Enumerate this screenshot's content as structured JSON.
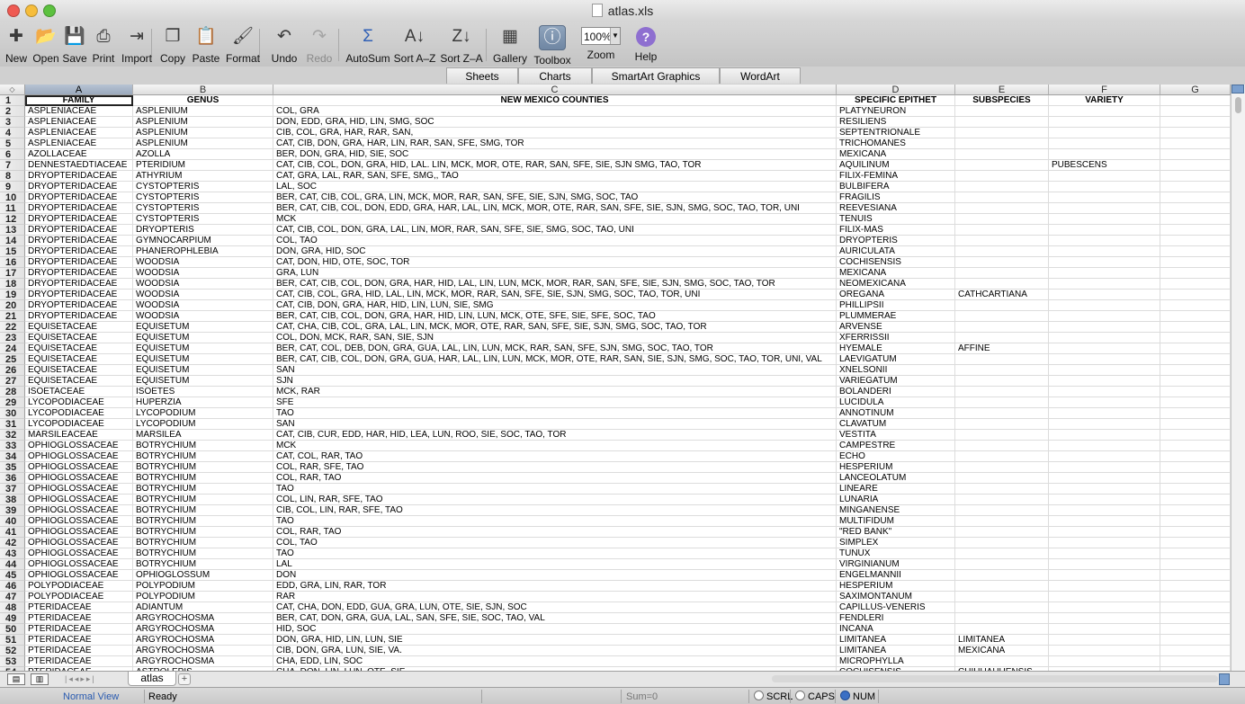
{
  "window": {
    "title": "atlas.xls"
  },
  "toolbar": {
    "items": [
      {
        "label": "New",
        "icon": "new-file-icon",
        "glyph": "✚"
      },
      {
        "label": "Open",
        "icon": "open-icon",
        "glyph": "📂"
      },
      {
        "label": "Save",
        "icon": "save-icon",
        "glyph": "💾"
      },
      {
        "label": "Print",
        "icon": "print-icon",
        "glyph": "⎙"
      },
      {
        "label": "Import",
        "icon": "import-icon",
        "glyph": "⇥"
      },
      {
        "label": "Copy",
        "icon": "copy-icon",
        "glyph": "❐"
      },
      {
        "label": "Paste",
        "icon": "paste-icon",
        "glyph": "📋"
      },
      {
        "label": "Format",
        "icon": "format-brush-icon",
        "glyph": "🖌"
      },
      {
        "label": "Undo",
        "icon": "undo-icon",
        "glyph": "↶"
      },
      {
        "label": "Redo",
        "icon": "redo-icon",
        "glyph": "↷"
      },
      {
        "label": "AutoSum",
        "icon": "autosum-icon",
        "glyph": "Σ"
      },
      {
        "label": "Sort A–Z",
        "icon": "sort-ascending-icon",
        "glyph": "A↓"
      },
      {
        "label": "Sort Z–A",
        "icon": "sort-descending-icon",
        "glyph": "Z↓"
      },
      {
        "label": "Gallery",
        "icon": "gallery-icon",
        "glyph": "▦"
      },
      {
        "label": "Toolbox",
        "icon": "toolbox-icon",
        "glyph": "ⓘ"
      },
      {
        "label": "Zoom",
        "icon": "zoom-icon",
        "glyph": ""
      },
      {
        "label": "Help",
        "icon": "help-icon",
        "glyph": "?"
      }
    ],
    "zoom_value": "100%"
  },
  "ribbon": {
    "tabs": [
      "Sheets",
      "Charts",
      "SmartArt Graphics",
      "WordArt"
    ]
  },
  "sheet": {
    "columns": [
      "A",
      "B",
      "C",
      "D",
      "E",
      "F",
      "G"
    ],
    "header_row": [
      "FAMILY",
      "GENUS",
      "NEW MEXICO COUNTIES",
      "SPECIFIC EPITHET",
      "SUBSPECIES",
      "VARIETY",
      ""
    ],
    "rows": [
      [
        "ASPLENIACEAE",
        "ASPLENIUM",
        "COL, GRA",
        "PLATYNEURON",
        "",
        ""
      ],
      [
        "ASPLENIACEAE",
        "ASPLENIUM",
        "DON, EDD, GRA, HID, LIN, SMG, SOC",
        "RESILIENS",
        "",
        ""
      ],
      [
        "ASPLENIACEAE",
        "ASPLENIUM",
        "CIB, COL, GRA, HAR, RAR, SAN,",
        "SEPTENTRIONALE",
        "",
        ""
      ],
      [
        "ASPLENIACEAE",
        "ASPLENIUM",
        "CAT, CIB, DON, GRA, HAR, LIN, RAR, SAN, SFE, SMG, TOR",
        "TRICHOMANES",
        "",
        ""
      ],
      [
        "AZOLLACEAE",
        "AZOLLA",
        "BER, DON, GRA, HID, SIE, SOC",
        "MEXICANA",
        "",
        ""
      ],
      [
        "DENNESTAEDTIACEAE",
        "PTERIDIUM",
        "CAT, CIB, COL, DON, GRA, HID, LAL. LIN, MCK, MOR, OTE, RAR, SAN, SFE, SIE, SJN SMG, TAO, TOR",
        "AQUILINUM",
        "",
        "PUBESCENS"
      ],
      [
        "DRYOPTERIDACEAE",
        "ATHYRIUM",
        "CAT, GRA, LAL, RAR, SAN, SFE, SMG,, TAO",
        "FILIX-FEMINA",
        "",
        ""
      ],
      [
        "DRYOPTERIDACEAE",
        "CYSTOPTERIS",
        "LAL, SOC",
        "BULBIFERA",
        "",
        ""
      ],
      [
        "DRYOPTERIDACEAE",
        "CYSTOPTERIS",
        "BER, CAT, CIB, COL, GRA, LIN, MCK, MOR, RAR, SAN, SFE, SIE, SJN, SMG, SOC, TAO",
        "FRAGILIS",
        "",
        ""
      ],
      [
        "DRYOPTERIDACEAE",
        "CYSTOPTERIS",
        "BER, CAT, CIB, COL, DON, EDD, GRA, HAR, LAL, LIN, MCK, MOR, OTE, RAR, SAN, SFE, SIE, SJN, SMG, SOC, TAO, TOR, UNI",
        "REEVESIANA",
        "",
        ""
      ],
      [
        "DRYOPTERIDACEAE",
        "CYSTOPTERIS",
        "MCK",
        "TENUIS",
        "",
        ""
      ],
      [
        "DRYOPTERIDACEAE",
        "DRYOPTERIS",
        "CAT, CIB, COL, DON, GRA, LAL, LIN, MOR, RAR, SAN, SFE, SIE, SMG, SOC, TAO, UNI",
        "FILIX-MAS",
        "",
        ""
      ],
      [
        "DRYOPTERIDACEAE",
        "GYMNOCARPIUM",
        "COL, TAO",
        "DRYOPTERIS",
        "",
        ""
      ],
      [
        "DRYOPTERIDACEAE",
        "PHANEROPHLEBIA",
        "DON, GRA, HID, SOC",
        "AURICULATA",
        "",
        ""
      ],
      [
        "DRYOPTERIDACEAE",
        "WOODSIA",
        "CAT, DON, HID, OTE, SOC, TOR",
        "COCHISENSIS",
        "",
        ""
      ],
      [
        "DRYOPTERIDACEAE",
        "WOODSIA",
        "GRA, LUN",
        "MEXICANA",
        "",
        ""
      ],
      [
        "DRYOPTERIDACEAE",
        "WOODSIA",
        "BER, CAT, CIB, COL, DON, GRA, HAR, HID, LAL, LIN, LUN, MCK, MOR, RAR, SAN, SFE, SIE, SJN, SMG, SOC, TAO, TOR",
        "NEOMEXICANA",
        "",
        ""
      ],
      [
        "DRYOPTERIDACEAE",
        "WOODSIA",
        "CAT, CIB, COL, GRA, HID, LAL, LIN, MCK, MOR, RAR, SAN, SFE, SIE, SJN, SMG, SOC, TAO, TOR, UNI",
        "OREGANA",
        "CATHCARTIANA",
        ""
      ],
      [
        "DRYOPTERIDACEAE",
        "WOODSIA",
        "CAT, CIB, DON, GRA, HAR, HID, LIN, LUN, SIE, SMG",
        "PHILLIPSII",
        "",
        ""
      ],
      [
        "DRYOPTERIDACEAE",
        "WOODSIA",
        "BER, CAT, CIB, COL, DON, GRA, HAR, HID, LIN, LUN, MCK, OTE, SFE, SIE, SFE, SOC, TAO",
        "PLUMMERAE",
        "",
        ""
      ],
      [
        "EQUISETACEAE",
        "EQUISETUM",
        "CAT, CHA, CIB, COL, GRA, LAL, LIN, MCK, MOR, OTE, RAR, SAN, SFE, SIE, SJN, SMG, SOC, TAO, TOR",
        "ARVENSE",
        "",
        ""
      ],
      [
        "EQUISETACEAE",
        "EQUISETUM",
        "COL, DON, MCK, RAR, SAN, SIE, SJN",
        "XFERRISSII",
        "",
        ""
      ],
      [
        "EQUISETACEAE",
        "EQUISETUM",
        "BER, CAT, COL, DEB, DON, GRA, GUA, LAL, LIN, LUN, MCK, RAR, SAN, SFE, SJN, SMG, SOC, TAO, TOR",
        "HYEMALE",
        "AFFINE",
        ""
      ],
      [
        "EQUISETACEAE",
        "EQUISETUM",
        "BER, CAT, CIB, COL, DON, GRA, GUA, HAR, LAL, LIN, LUN, MCK, MOR, OTE, RAR, SAN, SIE, SJN, SMG, SOC, TAO, TOR, UNI, VAL",
        "LAEVIGATUM",
        "",
        ""
      ],
      [
        "EQUISETACEAE",
        "EQUISETUM",
        "SAN",
        "XNELSONII",
        "",
        ""
      ],
      [
        "EQUISETACEAE",
        "EQUISETUM",
        "SJN",
        "VARIEGATUM",
        "",
        ""
      ],
      [
        "ISOETACEAE",
        "ISOETES",
        "MCK, RAR",
        "BOLANDERI",
        "",
        ""
      ],
      [
        "LYCOPODIACEAE",
        "HUPERZIA",
        "SFE",
        "LUCIDULA",
        "",
        ""
      ],
      [
        "LYCOPODIACEAE",
        "LYCOPODIUM",
        "TAO",
        "ANNOTINUM",
        "",
        ""
      ],
      [
        "LYCOPODIACEAE",
        "LYCOPODIUM",
        "SAN",
        "CLAVATUM",
        "",
        ""
      ],
      [
        "MARSILEACEAE",
        "MARSILEA",
        "CAT, CIB, CUR, EDD, HAR, HID, LEA, LUN, ROO, SIE, SOC, TAO, TOR",
        "VESTITA",
        "",
        ""
      ],
      [
        "OPHIOGLOSSACEAE",
        "BOTRYCHIUM",
        "MCK",
        "CAMPESTRE",
        "",
        ""
      ],
      [
        "OPHIOGLOSSACEAE",
        "BOTRYCHIUM",
        "CAT, COL, RAR, TAO",
        "ECHO",
        "",
        ""
      ],
      [
        "OPHIOGLOSSACEAE",
        "BOTRYCHIUM",
        "COL, RAR, SFE, TAO",
        "HESPERIUM",
        "",
        ""
      ],
      [
        "OPHIOGLOSSACEAE",
        "BOTRYCHIUM",
        "COL, RAR, TAO",
        "LANCEOLATUM",
        "",
        ""
      ],
      [
        "OPHIOGLOSSACEAE",
        "BOTRYCHIUM",
        "TAO",
        "LINEARE",
        "",
        ""
      ],
      [
        "OPHIOGLOSSACEAE",
        "BOTRYCHIUM",
        "COL, LIN, RAR, SFE, TAO",
        "LUNARIA",
        "",
        ""
      ],
      [
        "OPHIOGLOSSACEAE",
        "BOTRYCHIUM",
        "CIB, COL, LIN, RAR, SFE, TAO",
        "MINGANENSE",
        "",
        ""
      ],
      [
        "OPHIOGLOSSACEAE",
        "BOTRYCHIUM",
        "TAO",
        "MULTIFIDUM",
        "",
        ""
      ],
      [
        "OPHIOGLOSSACEAE",
        "BOTRYCHIUM",
        "COL, RAR, TAO",
        "\"RED BANK\"",
        "",
        ""
      ],
      [
        "OPHIOGLOSSACEAE",
        "BOTRYCHIUM",
        "COL, TAO",
        "SIMPLEX",
        "",
        ""
      ],
      [
        "OPHIOGLOSSACEAE",
        "BOTRYCHIUM",
        "TAO",
        "TUNUX",
        "",
        ""
      ],
      [
        "OPHIOGLOSSACEAE",
        "BOTRYCHIUM",
        "LAL",
        "VIRGINIANUM",
        "",
        ""
      ],
      [
        "OPHIOGLOSSACEAE",
        "OPHIOGLOSSUM",
        "DON",
        "ENGELMANNII",
        "",
        ""
      ],
      [
        "POLYPODIACEAE",
        "POLYPODIUM",
        "EDD, GRA, LIN, RAR, TOR",
        "HESPERIUM",
        "",
        ""
      ],
      [
        "POLYPODIACEAE",
        "POLYPODIUM",
        "RAR",
        "SAXIMONTANUM",
        "",
        ""
      ],
      [
        "PTERIDACEAE",
        "ADIANTUM",
        "CAT, CHA, DON, EDD, GUA, GRA, LUN, OTE, SIE, SJN, SOC",
        "CAPILLUS-VENERIS",
        "",
        ""
      ],
      [
        "PTERIDACEAE",
        "ARGYROCHOSMA",
        "BER, CAT, DON, GRA, GUA, LAL, SAN, SFE, SIE, SOC, TAO, VAL",
        "FENDLERI",
        "",
        ""
      ],
      [
        "PTERIDACEAE",
        "ARGYROCHOSMA",
        "HID, SOC",
        "INCANA",
        "",
        ""
      ],
      [
        "PTERIDACEAE",
        "ARGYROCHOSMA",
        "DON, GRA, HID, LIN, LUN, SIE",
        "LIMITANEA",
        "LIMITANEA",
        ""
      ],
      [
        "PTERIDACEAE",
        "ARGYROCHOSMA",
        "CIB, DON, GRA, LUN, SIE, VA.",
        "LIMITANEA",
        "MEXICANA",
        ""
      ],
      [
        "PTERIDACEAE",
        "ARGYROCHOSMA",
        "CHA, EDD, LIN, SOC",
        "MICROPHYLLA",
        "",
        ""
      ],
      [
        "PTERIDACEAE",
        "ASTROLEPIS",
        "CHA, DON, LIN, LUN, OTE, SIE",
        "COCHISENSIS",
        "CHIHUAHUENSIS",
        ""
      ]
    ]
  },
  "sheet_tabs": {
    "active": "atlas"
  },
  "status": {
    "view": "Normal View",
    "ready": "Ready",
    "sum": "Sum=0",
    "scrl": "SCRL",
    "caps": "CAPS",
    "num": "NUM"
  },
  "colors": {
    "selected_header": "#9aa9bd",
    "toolbox_active": "#6f86a3"
  }
}
